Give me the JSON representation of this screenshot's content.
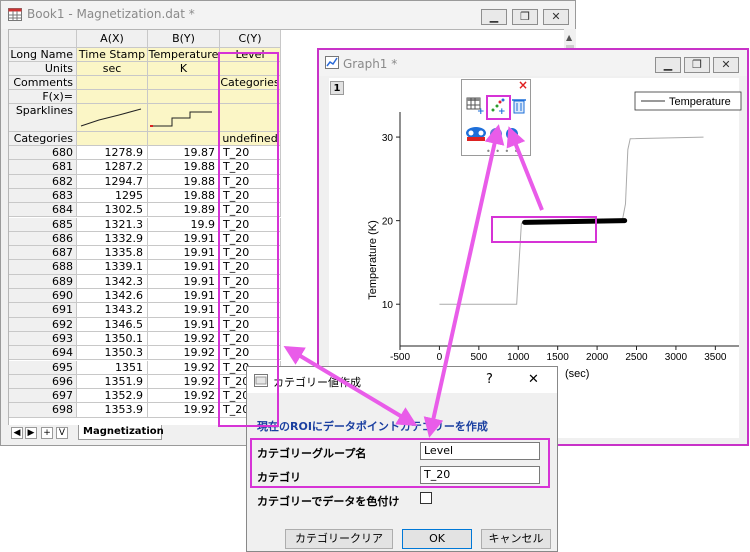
{
  "book": {
    "title": "Book1 - Magnetization.dat *",
    "columns": [
      {
        "header": "A(X)",
        "long_name": "Time Stamp",
        "units": "sec",
        "comments": "",
        "categories": ""
      },
      {
        "header": "B(Y)",
        "long_name": "Temperature",
        "units": "K",
        "comments": "",
        "categories": ""
      },
      {
        "header": "C(Y)",
        "long_name": "Level",
        "units": "",
        "comments": "Categories",
        "categories": "undefined"
      }
    ],
    "row_labels": {
      "long_name": "Long Name",
      "units": "Units",
      "comments": "Comments",
      "fx": "F(x)=",
      "sparklines": "Sparklines",
      "categories": "Categories"
    },
    "rows": [
      {
        "n": "680",
        "a": "1278.9",
        "b": "19.87",
        "c": "T_20"
      },
      {
        "n": "681",
        "a": "1287.2",
        "b": "19.88",
        "c": "T_20"
      },
      {
        "n": "682",
        "a": "1294.7",
        "b": "19.88",
        "c": "T_20"
      },
      {
        "n": "683",
        "a": "1295",
        "b": "19.88",
        "c": "T_20"
      },
      {
        "n": "684",
        "a": "1302.5",
        "b": "19.89",
        "c": "T_20"
      },
      {
        "n": "685",
        "a": "1321.3",
        "b": "19.9",
        "c": "T_20"
      },
      {
        "n": "686",
        "a": "1332.9",
        "b": "19.91",
        "c": "T_20"
      },
      {
        "n": "687",
        "a": "1335.8",
        "b": "19.91",
        "c": "T_20"
      },
      {
        "n": "688",
        "a": "1339.1",
        "b": "19.91",
        "c": "T_20"
      },
      {
        "n": "689",
        "a": "1342.3",
        "b": "19.91",
        "c": "T_20"
      },
      {
        "n": "690",
        "a": "1342.6",
        "b": "19.91",
        "c": "T_20"
      },
      {
        "n": "691",
        "a": "1343.2",
        "b": "19.91",
        "c": "T_20"
      },
      {
        "n": "692",
        "a": "1346.5",
        "b": "19.91",
        "c": "T_20"
      },
      {
        "n": "693",
        "a": "1350.1",
        "b": "19.92",
        "c": "T_20"
      },
      {
        "n": "694",
        "a": "1350.3",
        "b": "19.92",
        "c": "T_20"
      },
      {
        "n": "695",
        "a": "1351",
        "b": "19.92",
        "c": "T_20"
      },
      {
        "n": "696",
        "a": "1351.9",
        "b": "19.92",
        "c": "T_20"
      },
      {
        "n": "697",
        "a": "1352.9",
        "b": "19.92",
        "c": "T_20"
      },
      {
        "n": "698",
        "a": "1353.9",
        "b": "19.92",
        "c": "T_20"
      }
    ],
    "sheet_tab": "Magnetization"
  },
  "graph": {
    "title": "Graph1 *",
    "layer": "1",
    "legend": "Temperature",
    "ylabel": "Temperature (K)",
    "xlabel": "(sec)",
    "xticks": [
      "-500",
      "0",
      "500",
      "1000",
      "1500",
      "2000",
      "2500",
      "3000",
      "3500"
    ],
    "yticks": [
      "10",
      "20",
      "30"
    ]
  },
  "chart_data": {
    "type": "line",
    "series": [
      {
        "name": "Temperature",
        "x": [
          0,
          980,
          1010,
          1040,
          1100,
          2320,
          2360,
          2390,
          2420,
          3350
        ],
        "y": [
          10.0,
          10.0,
          15.0,
          19.7,
          19.8,
          20.0,
          22.0,
          28.5,
          29.8,
          30.0
        ]
      }
    ],
    "highlighted": {
      "x": [
        1080,
        2350
      ],
      "y": [
        19.8,
        20.0
      ]
    },
    "xlim": [
      -500,
      3800
    ],
    "ylim": [
      5,
      33
    ],
    "legend_position": "top-right",
    "colors": {
      "line": "#aaaaaa",
      "highlight": "#000000",
      "annotation": "#e95ce9"
    }
  },
  "toolbar": {
    "icons": [
      "table-add-icon",
      "scatter-add-icon",
      "delete-icon",
      "mask-icon",
      "settings-icon"
    ],
    "close": "×"
  },
  "dialog": {
    "title": "カテゴリー値作成",
    "help": "?",
    "close": "✕",
    "heading": "現在のROIにデータポイントカテゴリーを作成",
    "group_label": "カテゴリーグループ名",
    "group_value": "Level",
    "category_label": "カテゴリ",
    "category_value": "T_20",
    "color_label": "カテゴリーでデータを色付け",
    "clear_button": "カテゴリークリア",
    "ok_button": "OK",
    "cancel_button": "キャンセル"
  }
}
